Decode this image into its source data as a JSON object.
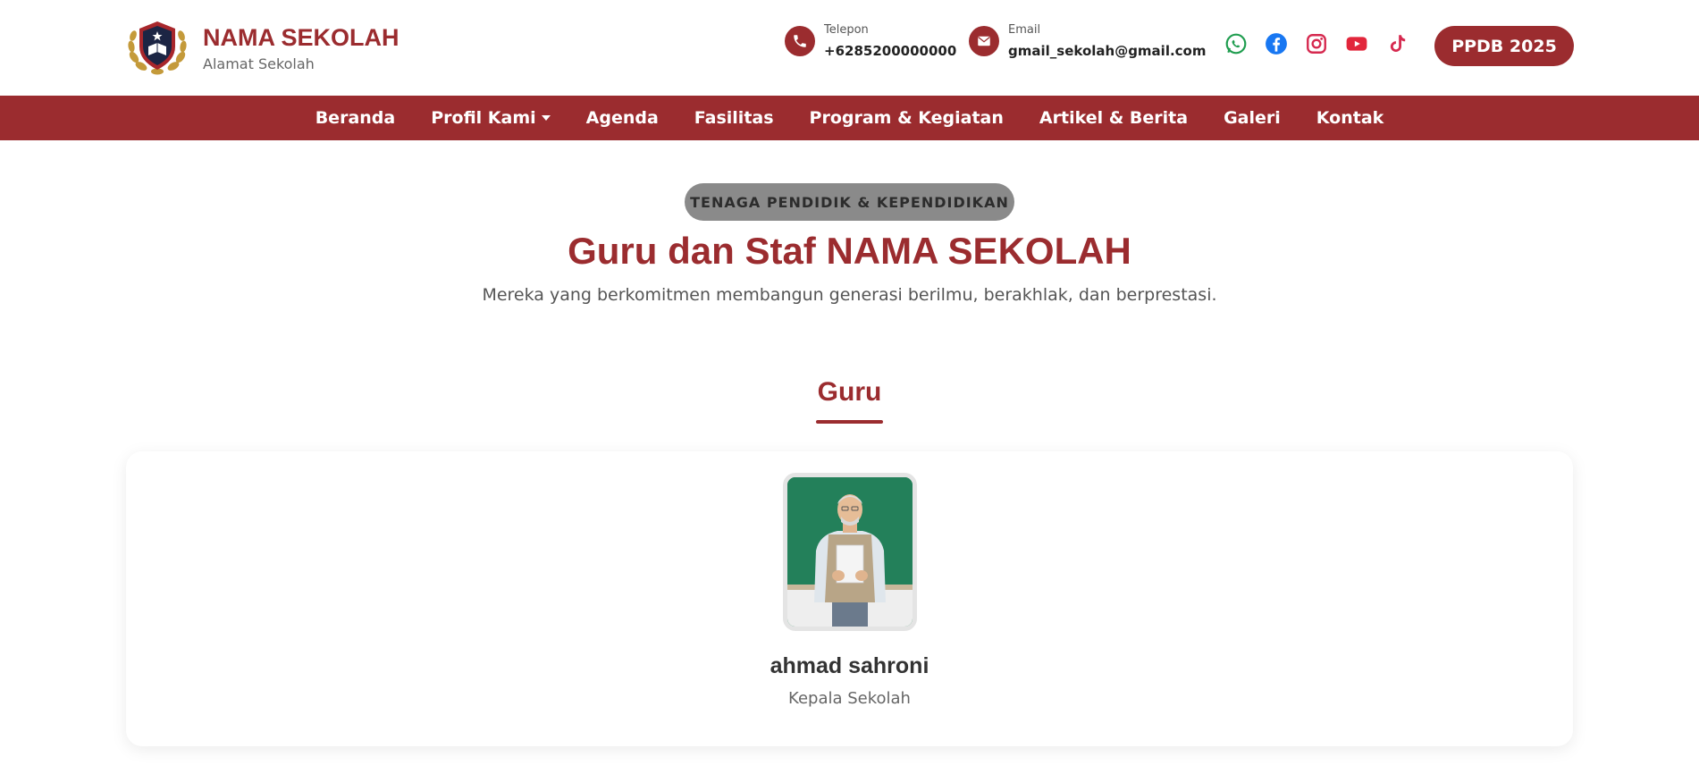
{
  "brand": {
    "name": "NAMA SEKOLAH",
    "address": "Alamat Sekolah"
  },
  "contact": {
    "phone_label": "Telepon",
    "phone_value": "+6285200000000",
    "email_label": "Email",
    "email_value": "gmail_sekolah@gmail.com"
  },
  "socials": [
    {
      "name": "whatsapp-icon",
      "color": "#1f9d4f"
    },
    {
      "name": "facebook-icon",
      "color": "#1877f2"
    },
    {
      "name": "instagram-icon",
      "color": "#d6294f"
    },
    {
      "name": "youtube-icon",
      "color": "#e2263b"
    },
    {
      "name": "tiktok-icon",
      "color": "#d6294f"
    }
  ],
  "cta": {
    "ppdb_label": "PPDB 2025"
  },
  "nav": {
    "items": [
      {
        "label": "Beranda"
      },
      {
        "label": "Profil Kami"
      },
      {
        "label": "Agenda"
      },
      {
        "label": "Fasilitas"
      },
      {
        "label": "Program & Kegiatan"
      },
      {
        "label": "Artikel & Berita"
      },
      {
        "label": "Galeri"
      },
      {
        "label": "Kontak"
      }
    ]
  },
  "hero": {
    "tag": "TENAGA PENDIDIK & KEPENDIDIKAN",
    "title": "Guru dan Staf NAMA SEKOLAH",
    "subtitle": "Mereka yang berkomitmen membangun generasi berilmu, berakhlak, dan berprestasi."
  },
  "section": {
    "title": "Guru",
    "members": [
      {
        "name": "ahmad sahroni",
        "role": "Kepala Sekolah"
      }
    ]
  },
  "colors": {
    "brand": "#9b2c2f",
    "tag_bg": "#8a8a8a"
  }
}
